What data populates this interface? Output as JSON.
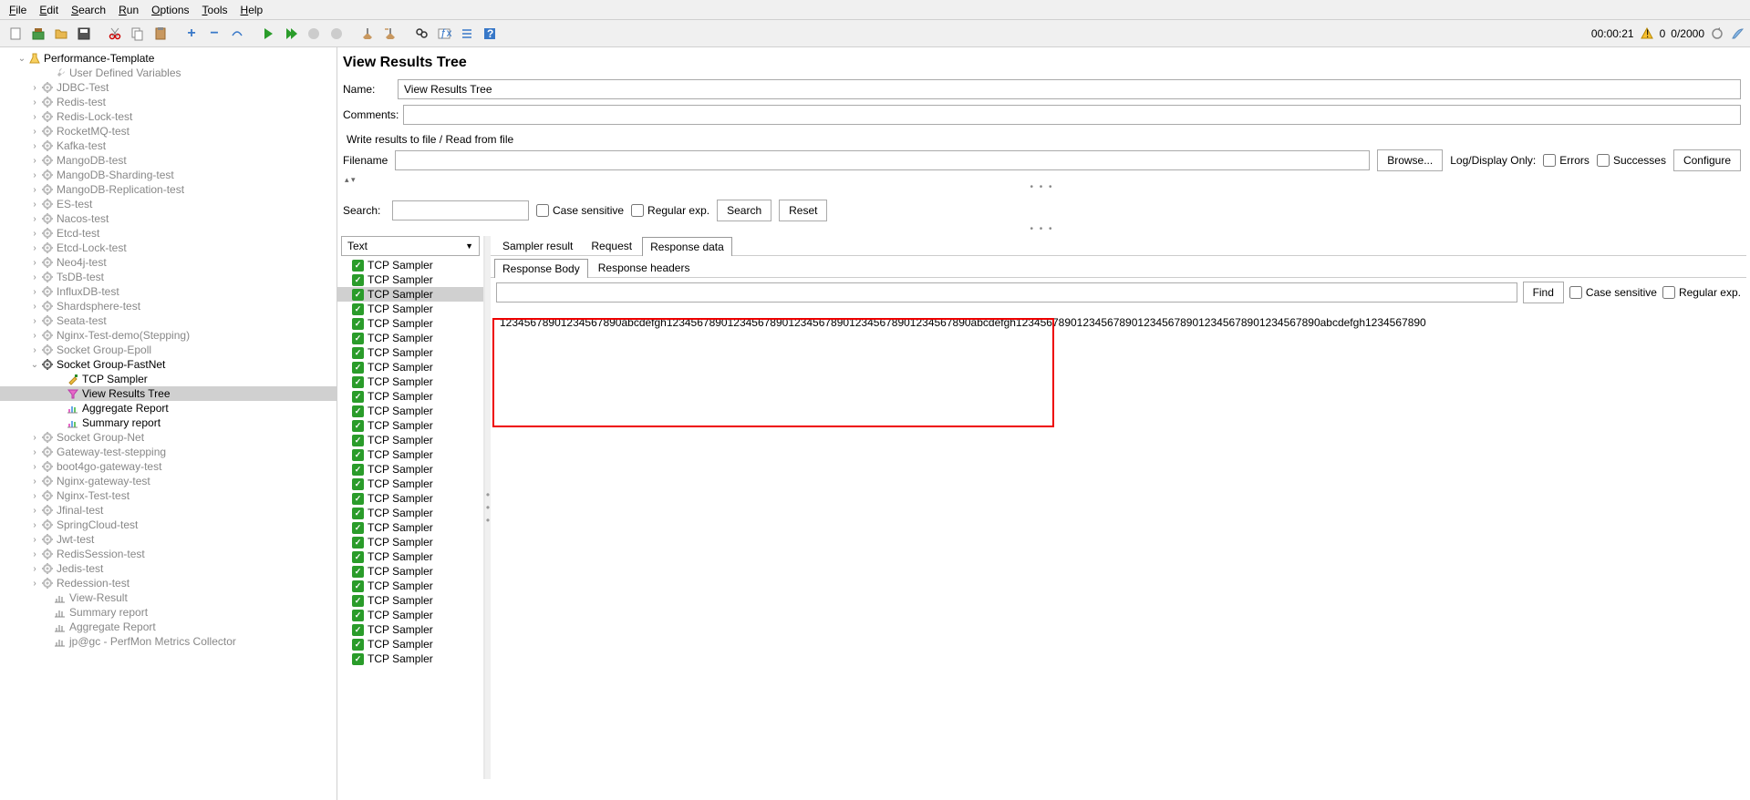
{
  "menu": {
    "items": [
      "File",
      "Edit",
      "Search",
      "Run",
      "Options",
      "Tools",
      "Help"
    ]
  },
  "toolbar": {
    "time": "00:00:21",
    "warn_count": "0",
    "thread_count": "0/2000"
  },
  "tree": {
    "root": "Performance-Template",
    "items": [
      {
        "indent": 1,
        "toggle": "v",
        "icon": "beaker",
        "label": "Performance-Template"
      },
      {
        "indent": 3,
        "toggle": "",
        "icon": "wrench-dim",
        "label": "User Defined Variables",
        "dim": true
      },
      {
        "indent": 2,
        "toggle": ">",
        "icon": "gear-dim",
        "label": "JDBC-Test",
        "dim": true
      },
      {
        "indent": 2,
        "toggle": ">",
        "icon": "gear-dim",
        "label": "Redis-test",
        "dim": true
      },
      {
        "indent": 2,
        "toggle": ">",
        "icon": "gear-dim",
        "label": "Redis-Lock-test",
        "dim": true
      },
      {
        "indent": 2,
        "toggle": ">",
        "icon": "gear-dim",
        "label": "RocketMQ-test",
        "dim": true
      },
      {
        "indent": 2,
        "toggle": ">",
        "icon": "gear-dim",
        "label": "Kafka-test",
        "dim": true
      },
      {
        "indent": 2,
        "toggle": ">",
        "icon": "gear-dim",
        "label": "MangoDB-test",
        "dim": true
      },
      {
        "indent": 2,
        "toggle": ">",
        "icon": "gear-dim",
        "label": "MangoDB-Sharding-test",
        "dim": true
      },
      {
        "indent": 2,
        "toggle": ">",
        "icon": "gear-dim",
        "label": "MangoDB-Replication-test",
        "dim": true
      },
      {
        "indent": 2,
        "toggle": ">",
        "icon": "gear-dim",
        "label": "ES-test",
        "dim": true
      },
      {
        "indent": 2,
        "toggle": ">",
        "icon": "gear-dim",
        "label": "Nacos-test",
        "dim": true
      },
      {
        "indent": 2,
        "toggle": ">",
        "icon": "gear-dim",
        "label": "Etcd-test",
        "dim": true
      },
      {
        "indent": 2,
        "toggle": ">",
        "icon": "gear-dim",
        "label": "Etcd-Lock-test",
        "dim": true
      },
      {
        "indent": 2,
        "toggle": ">",
        "icon": "gear-dim",
        "label": "Neo4j-test",
        "dim": true
      },
      {
        "indent": 2,
        "toggle": ">",
        "icon": "gear-dim",
        "label": "TsDB-test",
        "dim": true
      },
      {
        "indent": 2,
        "toggle": ">",
        "icon": "gear-dim",
        "label": "InfluxDB-test",
        "dim": true
      },
      {
        "indent": 2,
        "toggle": ">",
        "icon": "gear-dim",
        "label": "Shardsphere-test",
        "dim": true
      },
      {
        "indent": 2,
        "toggle": ">",
        "icon": "gear-dim",
        "label": "Seata-test",
        "dim": true
      },
      {
        "indent": 2,
        "toggle": ">",
        "icon": "gear-dim",
        "label": "Nginx-Test-demo(Stepping)",
        "dim": true
      },
      {
        "indent": 2,
        "toggle": ">",
        "icon": "gear-dim",
        "label": "Socket Group-Epoll",
        "dim": true
      },
      {
        "indent": 2,
        "toggle": "v",
        "icon": "gear",
        "label": "Socket Group-FastNet"
      },
      {
        "indent": 4,
        "toggle": "",
        "icon": "pipette",
        "label": "TCP Sampler"
      },
      {
        "indent": 4,
        "toggle": "",
        "icon": "funnel",
        "label": "View Results Tree",
        "selected": true
      },
      {
        "indent": 4,
        "toggle": "",
        "icon": "chart",
        "label": "Aggregate Report"
      },
      {
        "indent": 4,
        "toggle": "",
        "icon": "chart",
        "label": "Summary report"
      },
      {
        "indent": 2,
        "toggle": ">",
        "icon": "gear-dim",
        "label": "Socket Group-Net",
        "dim": true
      },
      {
        "indent": 2,
        "toggle": ">",
        "icon": "gear-dim",
        "label": "Gateway-test-stepping",
        "dim": true
      },
      {
        "indent": 2,
        "toggle": ">",
        "icon": "gear-dim",
        "label": "boot4go-gateway-test",
        "dim": true
      },
      {
        "indent": 2,
        "toggle": ">",
        "icon": "gear-dim",
        "label": "Nginx-gateway-test",
        "dim": true
      },
      {
        "indent": 2,
        "toggle": ">",
        "icon": "gear-dim",
        "label": "Nginx-Test-test",
        "dim": true
      },
      {
        "indent": 2,
        "toggle": ">",
        "icon": "gear-dim",
        "label": "Jfinal-test",
        "dim": true
      },
      {
        "indent": 2,
        "toggle": ">",
        "icon": "gear-dim",
        "label": "SpringCloud-test",
        "dim": true
      },
      {
        "indent": 2,
        "toggle": ">",
        "icon": "gear-dim",
        "label": "Jwt-test",
        "dim": true
      },
      {
        "indent": 2,
        "toggle": ">",
        "icon": "gear-dim",
        "label": "RedisSession-test",
        "dim": true
      },
      {
        "indent": 2,
        "toggle": ">",
        "icon": "gear-dim",
        "label": "Jedis-test",
        "dim": true
      },
      {
        "indent": 2,
        "toggle": ">",
        "icon": "gear-dim",
        "label": "Redession-test",
        "dim": true
      },
      {
        "indent": 3,
        "toggle": "",
        "icon": "chart-dim",
        "label": "View-Result",
        "dim": true
      },
      {
        "indent": 3,
        "toggle": "",
        "icon": "chart-dim",
        "label": "Summary report",
        "dim": true
      },
      {
        "indent": 3,
        "toggle": "",
        "icon": "chart-dim",
        "label": "Aggregate Report",
        "dim": true
      },
      {
        "indent": 3,
        "toggle": "",
        "icon": "chart-dim",
        "label": "jp@gc - PerfMon Metrics Collector",
        "dim": true
      }
    ]
  },
  "panel": {
    "title": "View Results Tree",
    "name_label": "Name:",
    "name_value": "View Results Tree",
    "comments_label": "Comments:",
    "comments_value": "",
    "write_section": "Write results to file / Read from file",
    "filename_label": "Filename",
    "filename_value": "",
    "browse": "Browse...",
    "log_only": "Log/Display Only:",
    "errors": "Errors",
    "successes": "Successes",
    "configure": "Configure",
    "search_label": "Search:",
    "case_sensitive": "Case sensitive",
    "regular_exp": "Regular exp.",
    "search_btn": "Search",
    "reset_btn": "Reset",
    "renderer": "Text"
  },
  "tabs": {
    "main": [
      "Sampler result",
      "Request",
      "Response data"
    ],
    "main_active": 2,
    "sub": [
      "Response Body",
      "Response headers"
    ],
    "sub_active": 0
  },
  "find": {
    "btn": "Find",
    "case_sensitive": "Case sensitive",
    "regular_exp": "Regular exp.",
    "value": ""
  },
  "result_list": {
    "count": 28,
    "selected": 2,
    "label": "TCP Sampler"
  },
  "response": {
    "body": "12345678901234567890abcdefgh12345678901234567890123456789012345678901234567890abcdefgh12345678901234567890123456789012345678901234567890abcdefgh1234567890"
  }
}
